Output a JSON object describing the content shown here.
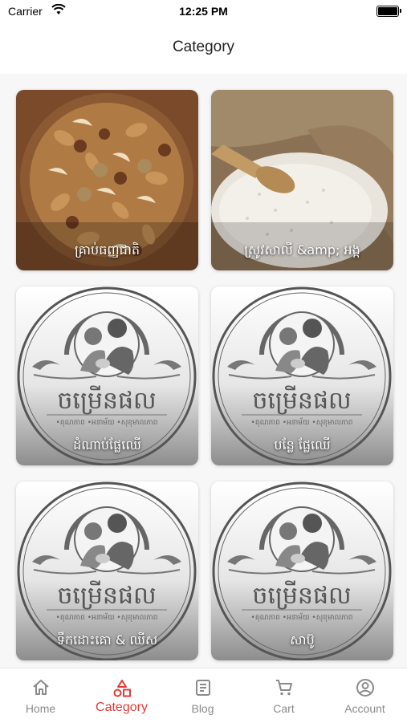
{
  "status_bar": {
    "carrier": "Carrier",
    "time": "12:25 PM"
  },
  "header": {
    "title": "Category"
  },
  "categories": [
    {
      "label": "គ្រាប់ធញ្ញជាតិ",
      "image": "mixed-nuts-photo"
    },
    {
      "label": "ស្រូវសាលី &amp; អង្ក",
      "image": "rice-sack-photo"
    },
    {
      "label": "ដំណាប់ផ្លែឈើ",
      "image": "brand-logo"
    },
    {
      "label": "បន្លែ ផ្លែឈើ",
      "image": "brand-logo"
    },
    {
      "label": "ទឹកដោះគោ & ឈីស",
      "image": "brand-logo"
    },
    {
      "label": "សាប៊ូ",
      "image": "brand-logo"
    }
  ],
  "brand_logo": {
    "name": "ចម្រើនផល",
    "tagline": "•គុណភាព •អនាម័យ •សុខុមាលភាព"
  },
  "tabs": [
    {
      "label": "Home",
      "icon": "home-icon",
      "active": false
    },
    {
      "label": "Category",
      "icon": "category-icon",
      "active": true
    },
    {
      "label": "Blog",
      "icon": "blog-icon",
      "active": false
    },
    {
      "label": "Cart",
      "icon": "cart-icon",
      "active": false
    },
    {
      "label": "Account",
      "icon": "account-icon",
      "active": false
    }
  ],
  "colors": {
    "accent": "#e53935",
    "inactive": "#8a8a8a"
  }
}
